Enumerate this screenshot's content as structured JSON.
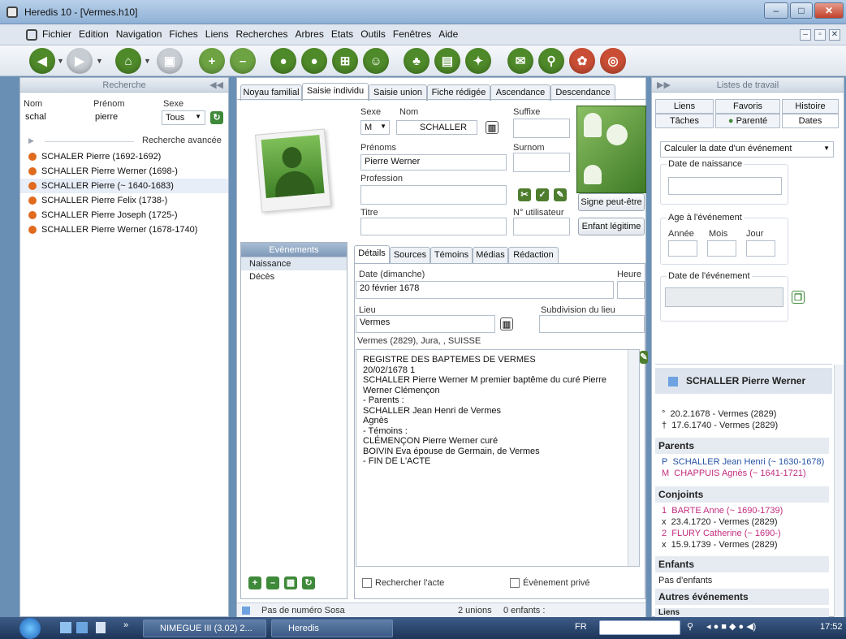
{
  "window": {
    "title": "Heredis 10 - [Vermes.h10]"
  },
  "menu": [
    "Fichier",
    "Edition",
    "Navigation",
    "Fiches",
    "Liens",
    "Recherches",
    "Arbres",
    "Etats",
    "Outils",
    "Fenêtres",
    "Aide"
  ],
  "toolbar_icons": [
    "back-icon",
    "forward-icon",
    "home-icon",
    "save-icon",
    "add-person-icon",
    "remove-person-icon",
    "person-icon",
    "couple-icon",
    "cart-icon",
    "family-icon",
    "tree-icon",
    "chart-icon",
    "idea-icon",
    "mail-icon",
    "search-icon",
    "palette-icon",
    "globe-icon"
  ],
  "search_panel": {
    "title": "Recherche",
    "nom_label": "Nom",
    "prenom_label": "Prénom",
    "sexe_label": "Sexe",
    "nom_value": "schal",
    "prenom_value": "pierre",
    "sexe_value": "Tous",
    "advanced": "Recherche avancée",
    "results": [
      "SCHALER Pierre (1692-1692)",
      "SCHALLER Pierre Werner (1698-)",
      "SCHALLER Pierre (~ 1640-1683)",
      "SCHALLER Pierre Felix (1738-)",
      "SCHALLER Pierre Joseph (1725-)",
      "SCHALLER Pierre Werner (1678-1740)"
    ]
  },
  "main_tabs": [
    "Noyau familial",
    "Saisie individu",
    "Saisie union",
    "Fiche rédigée",
    "Ascendance",
    "Descendance"
  ],
  "individual": {
    "sexe_label": "Sexe",
    "sexe_value": "M",
    "nom_label": "Nom",
    "nom_value": "SCHALLER",
    "suffixe_label": "Suffixe",
    "prenoms_label": "Prénoms",
    "prenoms_value": "Pierre Werner",
    "surnom_label": "Surnom",
    "profession_label": "Profession",
    "titre_label": "Titre",
    "numero_label": "N° utilisateur",
    "signe_button": "Signe peut-être",
    "enfant_button": "Enfant légitime"
  },
  "events": {
    "title": "Evènements",
    "list": [
      "Naissance",
      "Décès"
    ],
    "tabs": [
      "Détails",
      "Sources",
      "Témoins",
      "Médias",
      "Rédaction"
    ],
    "date_label": "Date (dimanche)",
    "date_value": "20 février 1678",
    "heure_label": "Heure",
    "lieu_label": "Lieu",
    "lieu_value": "Vermes",
    "subdivision_label": "Subdivision du lieu",
    "lieu_full": "Vermes (2829), Jura, , SUISSE",
    "note_lines": [
      "REGISTRE DES BAPTEMES DE VERMES",
      "20/02/1678 1",
      "SCHALLER Pierre Werner M premier baptême du curé Pierre",
      "Werner Clémençon",
      "- Parents :",
      "SCHALLER Jean Henri de Vermes",
      "Agnès",
      "- Témoins :",
      "CLÉMENÇON Pierre Werner curé",
      "BOIVIN Eva épouse de Germain, de Vermes",
      "- FIN DE L'ACTE"
    ],
    "rechercher_acte": "Rechercher l'acte",
    "evenement_prive": "Évènement privé"
  },
  "status": {
    "sosa": "Pas de numéro Sosa",
    "unions": "2 unions",
    "enfants": "0 enfants :"
  },
  "worklists": {
    "title": "Listes de travail",
    "tabs_row1": [
      "Liens",
      "Favoris",
      "Histoire"
    ],
    "tabs_row2": [
      "Tâches",
      "Parenté",
      "Dates"
    ],
    "calc_select": "Calculer la date d'un événement",
    "date_naissance": "Date de naissance",
    "age_label": "Age à l'événement",
    "annee": "Année",
    "mois": "Mois",
    "jour": "Jour",
    "date_evenement": "Date de l'événement"
  },
  "summary": {
    "name": "SCHALLER Pierre Werner",
    "birth": "20.2.1678 - Vermes (2829)",
    "death": "17.6.1740 - Vermes (2829)",
    "parents_title": "Parents",
    "father": "SCHALLER Jean Henri (~ 1630-1678)",
    "mother": "CHAPPUIS Agnès (~ 1641-1721)",
    "conjoints_title": "Conjoints",
    "spouse1": "BARTE Anne (~ 1690-1739)",
    "marriage1": "23.4.1720 - Vermes (2829)",
    "spouse2": "FLURY Catherine (~ 1690-)",
    "marriage2": "15.9.1739 - Vermes (2829)",
    "enfants_title": "Enfants",
    "no_children": "Pas d'enfants",
    "autres_title": "Autres événements",
    "liens_title": "Liens"
  },
  "taskbar": {
    "item1": "NIMEGUE III (3.02) 2...",
    "item2": "Heredis",
    "lang": "FR",
    "time": "17:52"
  },
  "colors": {
    "orange_dot": "#e06a1e",
    "pink": "#c22c7e",
    "blue": "#2753a4",
    "green": "#4f8a2a"
  }
}
